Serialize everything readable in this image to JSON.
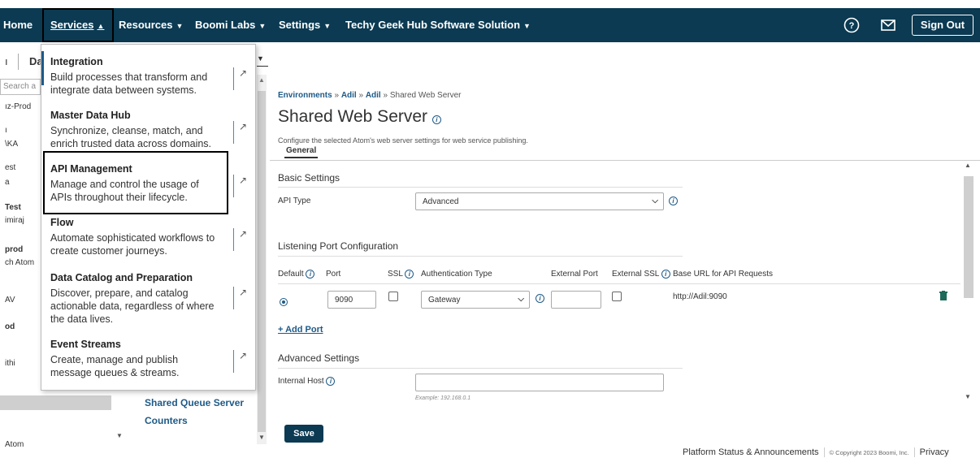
{
  "topnav": {
    "home": "Home",
    "services": "Services",
    "resources": "Resources",
    "boomi_labs": "Boomi Labs",
    "settings": "Settings",
    "account": "Techy Geek Hub Software Solution",
    "sign_out": "Sign Out"
  },
  "subbar": {
    "left1": "ı",
    "left2": "Da"
  },
  "left_list": {
    "search_placeholder": "Search a",
    "items": [
      "ız-Prod",
      "ı",
      "\\KA",
      "est",
      "a",
      "Test",
      "imiraj",
      "prod",
      "ch Atom",
      "AV",
      "od",
      "ithi",
      "Atom"
    ]
  },
  "mid_links": [
    "Shared Queue Server",
    "Counters"
  ],
  "services_menu": [
    {
      "title": "Integration",
      "desc": "Build processes that transform and integrate data between systems."
    },
    {
      "title": "Master Data Hub",
      "desc": "Synchronize, cleanse, match, and enrich trusted data across domains."
    },
    {
      "title": "API Management",
      "desc": "Manage and control the usage of APIs throughout their lifecycle."
    },
    {
      "title": "Flow",
      "desc": "Automate sophisticated workflows to create customer journeys."
    },
    {
      "title": "Data Catalog and Preparation",
      "desc": "Discover, prepare, and catalog actionable data, regardless of where the data lives."
    },
    {
      "title": "Event Streams",
      "desc": "Create, manage and publish message queues & streams."
    }
  ],
  "breadcrumb": {
    "env": "Environments",
    "a1": "Adil",
    "a2": "Adil",
    "current": "Shared Web Server",
    "sep": "»"
  },
  "page": {
    "title": "Shared Web Server",
    "description": "Configure the selected Atom's web server settings for web service publishing.",
    "tab": "General"
  },
  "basic": {
    "section": "Basic Settings",
    "api_type_label": "API Type",
    "api_type_value": "Advanced"
  },
  "listening": {
    "section": "Listening Port Configuration",
    "headers": {
      "default": "Default",
      "port": "Port",
      "ssl": "SSL",
      "auth": "Authentication Type",
      "external_port": "External Port",
      "external_ssl": "External SSL",
      "base_url": "Base URL for API Requests"
    },
    "row": {
      "port": "9090",
      "auth": "Gateway",
      "base_url": "http://Adil:9090"
    },
    "add_port": "+ Add Port"
  },
  "advanced": {
    "section": "Advanced Settings",
    "internal_host_label": "Internal Host",
    "internal_host_example": "Example: 192.168.0.1"
  },
  "save_label": "Save",
  "footer": {
    "status": "Platform Status & Announcements",
    "copyright": "© Copyright 2023 Boomi, Inc.",
    "privacy": "Privacy"
  }
}
